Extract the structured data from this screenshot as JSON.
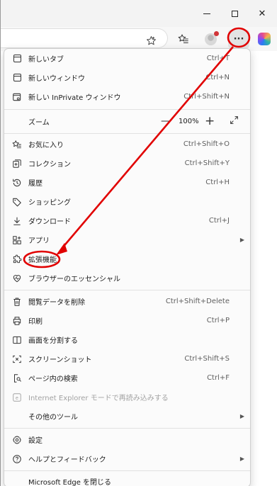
{
  "titlebar": {
    "minimize": "—",
    "maximize": "□",
    "close": "✕"
  },
  "toolbar": {
    "more_label": "···"
  },
  "menu": {
    "items": [
      {
        "label": "新しいタブ",
        "shortcut": "Ctrl+T",
        "icon": "new-tab-icon"
      },
      {
        "label": "新しいウィンドウ",
        "shortcut": "Ctrl+N",
        "icon": "new-window-icon"
      },
      {
        "label": "新しい InPrivate ウィンドウ",
        "shortcut": "Ctrl+Shift+N",
        "icon": "inprivate-icon"
      },
      {
        "label": "ズーム",
        "zoom_value": "100%",
        "icon": ""
      },
      {
        "label": "お気に入り",
        "shortcut": "Ctrl+Shift+O",
        "icon": "favorites-icon"
      },
      {
        "label": "コレクション",
        "shortcut": "Ctrl+Shift+Y",
        "icon": "collections-icon"
      },
      {
        "label": "履歴",
        "shortcut": "Ctrl+H",
        "icon": "history-icon"
      },
      {
        "label": "ショッピング",
        "shortcut": "",
        "icon": "shopping-tag-icon"
      },
      {
        "label": "ダウンロード",
        "shortcut": "Ctrl+J",
        "icon": "download-icon"
      },
      {
        "label": "アプリ",
        "shortcut": "",
        "icon": "apps-icon",
        "submenu": true
      },
      {
        "label": "拡張機能",
        "shortcut": "",
        "icon": "extensions-icon"
      },
      {
        "label": "ブラウザーのエッセンシャル",
        "shortcut": "",
        "icon": "essentials-heart-icon"
      },
      {
        "label": "閲覧データを削除",
        "shortcut": "Ctrl+Shift+Delete",
        "icon": "trash-icon"
      },
      {
        "label": "印刷",
        "shortcut": "Ctrl+P",
        "icon": "print-icon"
      },
      {
        "label": "画面を分割する",
        "shortcut": "",
        "icon": "split-screen-icon"
      },
      {
        "label": "スクリーンショット",
        "shortcut": "Ctrl+Shift+S",
        "icon": "screenshot-icon"
      },
      {
        "label": "ページ内の検索",
        "shortcut": "Ctrl+F",
        "icon": "find-icon"
      },
      {
        "label": "Internet Explorer モードで再読み込みする",
        "shortcut": "",
        "icon": "ie-mode-icon",
        "disabled": true
      },
      {
        "label": "その他のツール",
        "shortcut": "",
        "icon": "",
        "submenu": true
      },
      {
        "label": "設定",
        "shortcut": "",
        "icon": "settings-gear-icon"
      },
      {
        "label": "ヘルプとフィードバック",
        "shortcut": "",
        "icon": "help-icon",
        "submenu": true
      },
      {
        "label": "Microsoft Edge を閉じる",
        "shortcut": "",
        "icon": ""
      }
    ]
  },
  "zoom": {
    "minus": "—",
    "plus": "+",
    "value": "100%"
  },
  "colors": {
    "annotation": "#e10000",
    "menu_bg": "#fbfbfb",
    "disabled_text": "#a3a3a3"
  }
}
